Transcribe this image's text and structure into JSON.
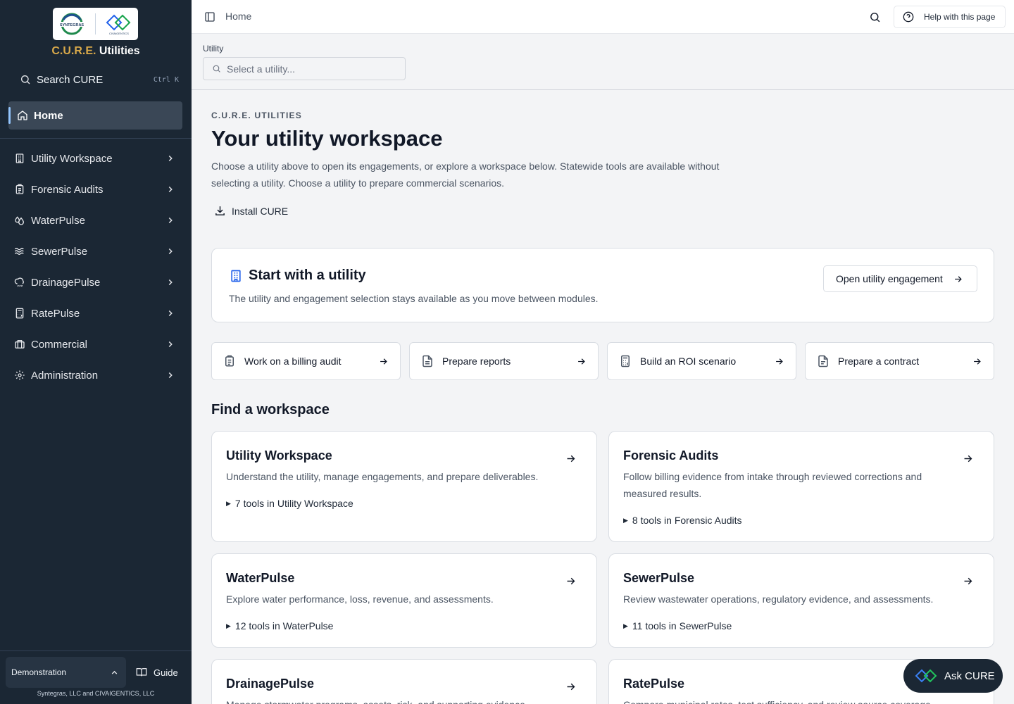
{
  "sidebar": {
    "logo_left": "SYNTEGRAS",
    "logo_right": "CIVAIGENTICS",
    "brand_part1": "C.U.R.E.",
    "brand_part2": "Utilities",
    "search_label": "Search CURE",
    "search_shortcut": "Ctrl K",
    "home_label": "Home",
    "items": [
      {
        "label": "Utility Workspace",
        "icon": "building-icon"
      },
      {
        "label": "Forensic Audits",
        "icon": "clipboard-icon"
      },
      {
        "label": "WaterPulse",
        "icon": "droplets-icon"
      },
      {
        "label": "SewerPulse",
        "icon": "waves-icon"
      },
      {
        "label": "DrainagePulse",
        "icon": "cloud-rain-icon"
      },
      {
        "label": "RatePulse",
        "icon": "calculator-icon"
      },
      {
        "label": "Commercial",
        "icon": "briefcase-icon"
      },
      {
        "label": "Administration",
        "icon": "gear-icon"
      }
    ],
    "mode_label": "Demonstration",
    "guide_label": "Guide",
    "copyright": "Syntegras, LLC and CIVAIGENTICS, LLC"
  },
  "topbar": {
    "breadcrumb": "Home",
    "help_label": "Help with this page"
  },
  "utility": {
    "label": "Utility",
    "placeholder": "Select a utility..."
  },
  "main": {
    "eyebrow": "C.U.R.E. UTILITIES",
    "title": "Your utility workspace",
    "intro": "Choose a utility above to open its engagements, or explore a workspace below. Statewide tools are available without selecting a utility. Choose a utility to prepare commercial scenarios.",
    "install_label": "Install CURE",
    "start_card": {
      "title": "Start with a utility",
      "description": "The utility and engagement selection stays available as you move between modules.",
      "button_label": "Open utility engagement"
    },
    "quick_actions": [
      {
        "label": "Work on a billing audit",
        "icon": "clipboard-list-icon"
      },
      {
        "label": "Prepare reports",
        "icon": "file-text-icon"
      },
      {
        "label": "Build an ROI scenario",
        "icon": "calculator-icon"
      },
      {
        "label": "Prepare a contract",
        "icon": "file-icon"
      }
    ],
    "section_title": "Find a workspace",
    "workspaces": [
      {
        "title": "Utility Workspace",
        "description": "Understand the utility, manage engagements, and prepare deliverables.",
        "tools": "7 tools in Utility Workspace"
      },
      {
        "title": "Forensic Audits",
        "description": "Follow billing evidence from intake through reviewed corrections and measured results.",
        "tools": "8 tools in Forensic Audits"
      },
      {
        "title": "WaterPulse",
        "description": "Explore water performance, loss, revenue, and assessments.",
        "tools": "12 tools in WaterPulse"
      },
      {
        "title": "SewerPulse",
        "description": "Review wastewater operations, regulatory evidence, and assessments.",
        "tools": "11 tools in SewerPulse"
      },
      {
        "title": "DrainagePulse",
        "description": "Manage stormwater programs, assets, risk, and supporting evidence.",
        "tools": ""
      },
      {
        "title": "RatePulse",
        "description": "Compare municipal rates, test sufficiency, and review source coverage.",
        "tools": ""
      }
    ]
  },
  "ask_cure_label": "Ask CURE",
  "colors": {
    "sidebar_bg": "#1b2734",
    "brand_gold": "#d9a94a",
    "active_item_bg": "#3a4756",
    "page_bg": "#f3f4f6"
  }
}
